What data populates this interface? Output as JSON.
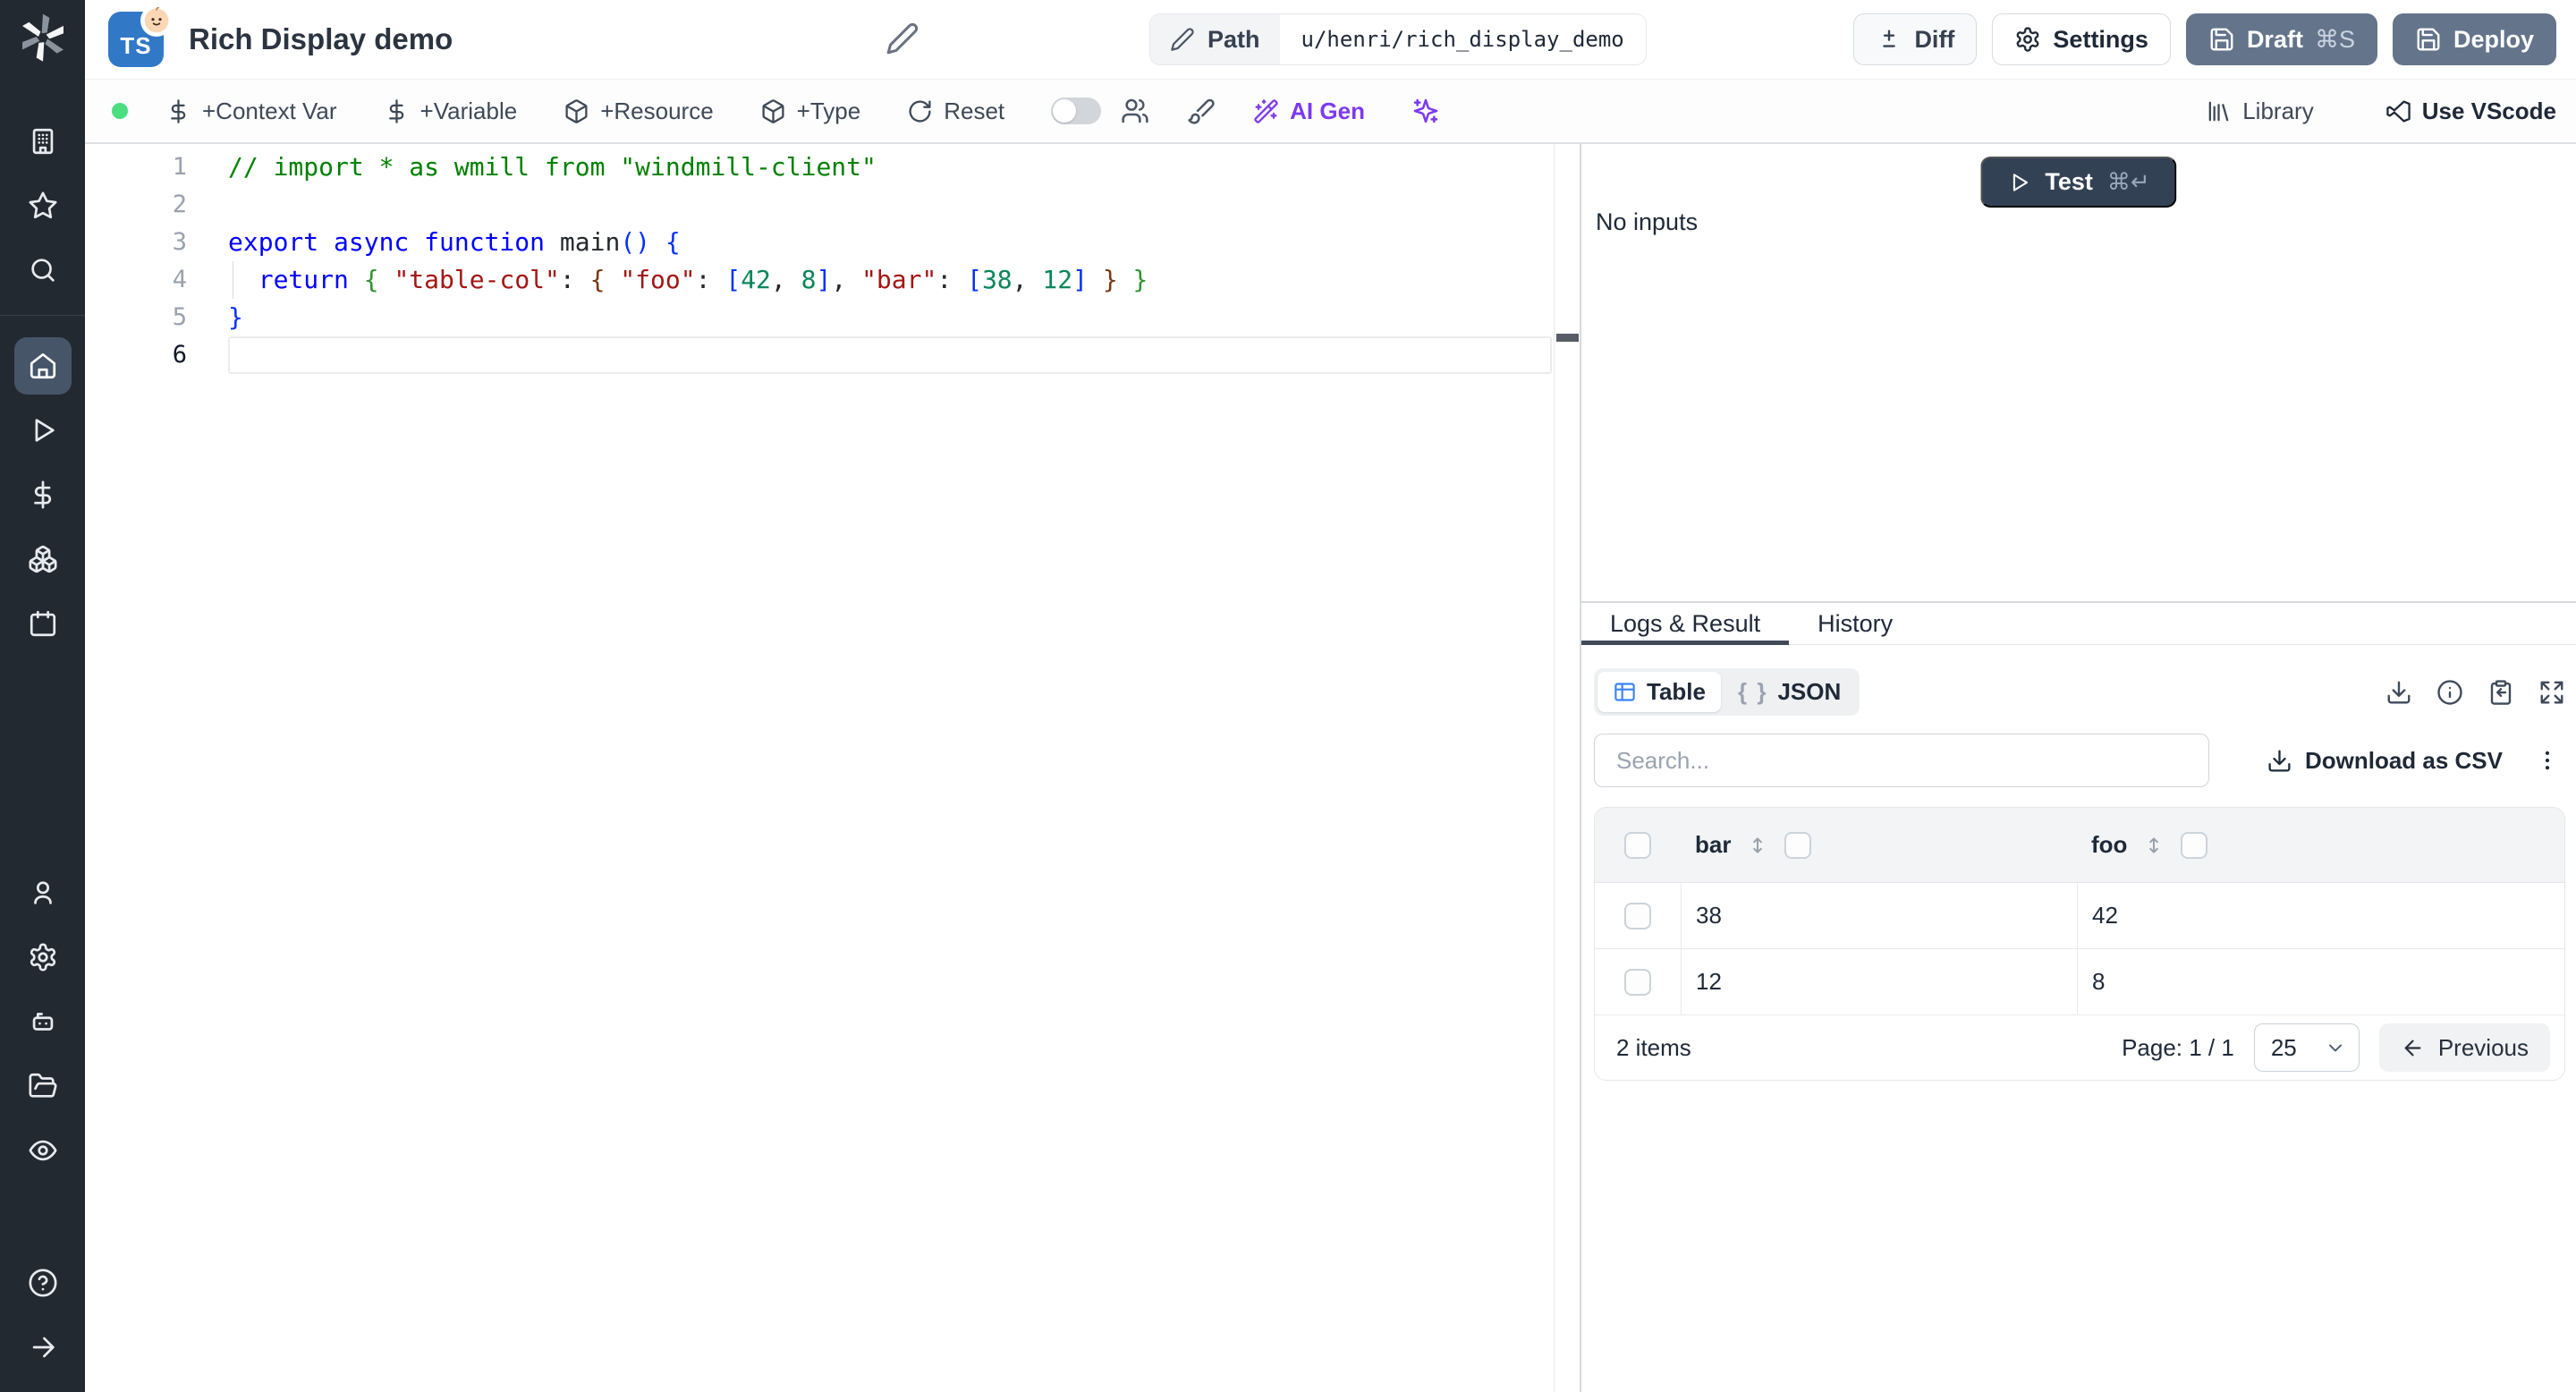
{
  "app": {
    "title": "Rich Display demo",
    "lang_badge": "TS"
  },
  "header": {
    "path_label": "Path",
    "path_value": "u/henri/rich_display_demo",
    "diff_label": "Diff",
    "settings_label": "Settings",
    "draft_label": "Draft",
    "draft_kbd": "⌘S",
    "deploy_label": "Deploy"
  },
  "toolbar": {
    "context_var": "+Context Var",
    "variable": "+Variable",
    "resource": "+Resource",
    "type": "+Type",
    "reset": "Reset",
    "ai_gen": "AI Gen",
    "library": "Library",
    "use_vscode": "Use VScode"
  },
  "sidebar": {
    "icons": [
      "windmill-logo",
      "building",
      "star",
      "search",
      "home",
      "play",
      "dollar",
      "boxes",
      "calendar",
      "user",
      "settings",
      "bot",
      "folder-open",
      "eye",
      "help",
      "arrow-right"
    ],
    "active": "home"
  },
  "editor": {
    "active_line": "6",
    "token_colors": {
      "comment": "#008000",
      "keyword": "#0000ff",
      "string": "#a31515",
      "number": "#098658",
      "b1": "#0431fa",
      "b2": "#319331",
      "b3": "#7b3814",
      "plain": "#24292e"
    },
    "lines": [
      {
        "num": "1",
        "tokens": [
          [
            "// import * as wmill from \"windmill-client\"",
            "comment"
          ]
        ]
      },
      {
        "num": "2",
        "tokens": []
      },
      {
        "num": "3",
        "tokens": [
          [
            "export async function",
            "keyword"
          ],
          [
            " ",
            "plain"
          ],
          [
            "main",
            "plain"
          ],
          [
            "()",
            "b1"
          ],
          [
            " ",
            "plain"
          ],
          [
            "{",
            "b1"
          ]
        ]
      },
      {
        "num": "4",
        "guide": true,
        "tokens": [
          [
            "  ",
            "plain"
          ],
          [
            "return",
            "keyword"
          ],
          [
            " ",
            "plain"
          ],
          [
            "{",
            "b2"
          ],
          [
            " ",
            "plain"
          ],
          [
            "\"table-col\"",
            "string"
          ],
          [
            ":",
            "plain"
          ],
          [
            " ",
            "plain"
          ],
          [
            "{",
            "b3"
          ],
          [
            " ",
            "plain"
          ],
          [
            "\"foo\"",
            "string"
          ],
          [
            ":",
            "plain"
          ],
          [
            " ",
            "plain"
          ],
          [
            "[",
            "b1"
          ],
          [
            "42",
            "number"
          ],
          [
            ",",
            "plain"
          ],
          [
            " ",
            "plain"
          ],
          [
            "8",
            "number"
          ],
          [
            "]",
            "b1"
          ],
          [
            ",",
            "plain"
          ],
          [
            " ",
            "plain"
          ],
          [
            "\"bar\"",
            "string"
          ],
          [
            ":",
            "plain"
          ],
          [
            " ",
            "plain"
          ],
          [
            "[",
            "b1"
          ],
          [
            "38",
            "number"
          ],
          [
            ",",
            "plain"
          ],
          [
            " ",
            "plain"
          ],
          [
            "12",
            "number"
          ],
          [
            "]",
            "b1"
          ],
          [
            " ",
            "plain"
          ],
          [
            "}",
            "b3"
          ],
          [
            " ",
            "plain"
          ],
          [
            "}",
            "b2"
          ]
        ]
      },
      {
        "num": "5",
        "tokens": [
          [
            "}",
            "b1"
          ]
        ]
      },
      {
        "num": "6",
        "tokens": []
      }
    ]
  },
  "run_panel": {
    "test_label": "Test",
    "test_kbd": "⌘↵",
    "no_inputs": "No inputs"
  },
  "result_panel": {
    "tabs": [
      {
        "label": "Logs & Result",
        "active": true
      },
      {
        "label": "History",
        "active": false
      }
    ],
    "view_toggle": {
      "table_label": "Table",
      "json_label": "JSON",
      "braces_glyph": "{ }"
    },
    "search_placeholder": "Search...",
    "download_csv_label": "Download as CSV",
    "table": {
      "columns": [
        "bar",
        "foo"
      ],
      "rows": [
        [
          "38",
          "42"
        ],
        [
          "12",
          "8"
        ]
      ],
      "items_count": "2 items",
      "page_label": "Page: 1 / 1",
      "page_size": "25",
      "previous_label": "Previous"
    }
  },
  "colors": {
    "accent_blue": "#3b82f6",
    "ts_blue": "#3178c6",
    "slate_button": "#64748b",
    "test_button": "#334155",
    "ai_purple": "#7c3aed",
    "status_green": "#4ade80",
    "sidebar_bg": "#232931"
  }
}
